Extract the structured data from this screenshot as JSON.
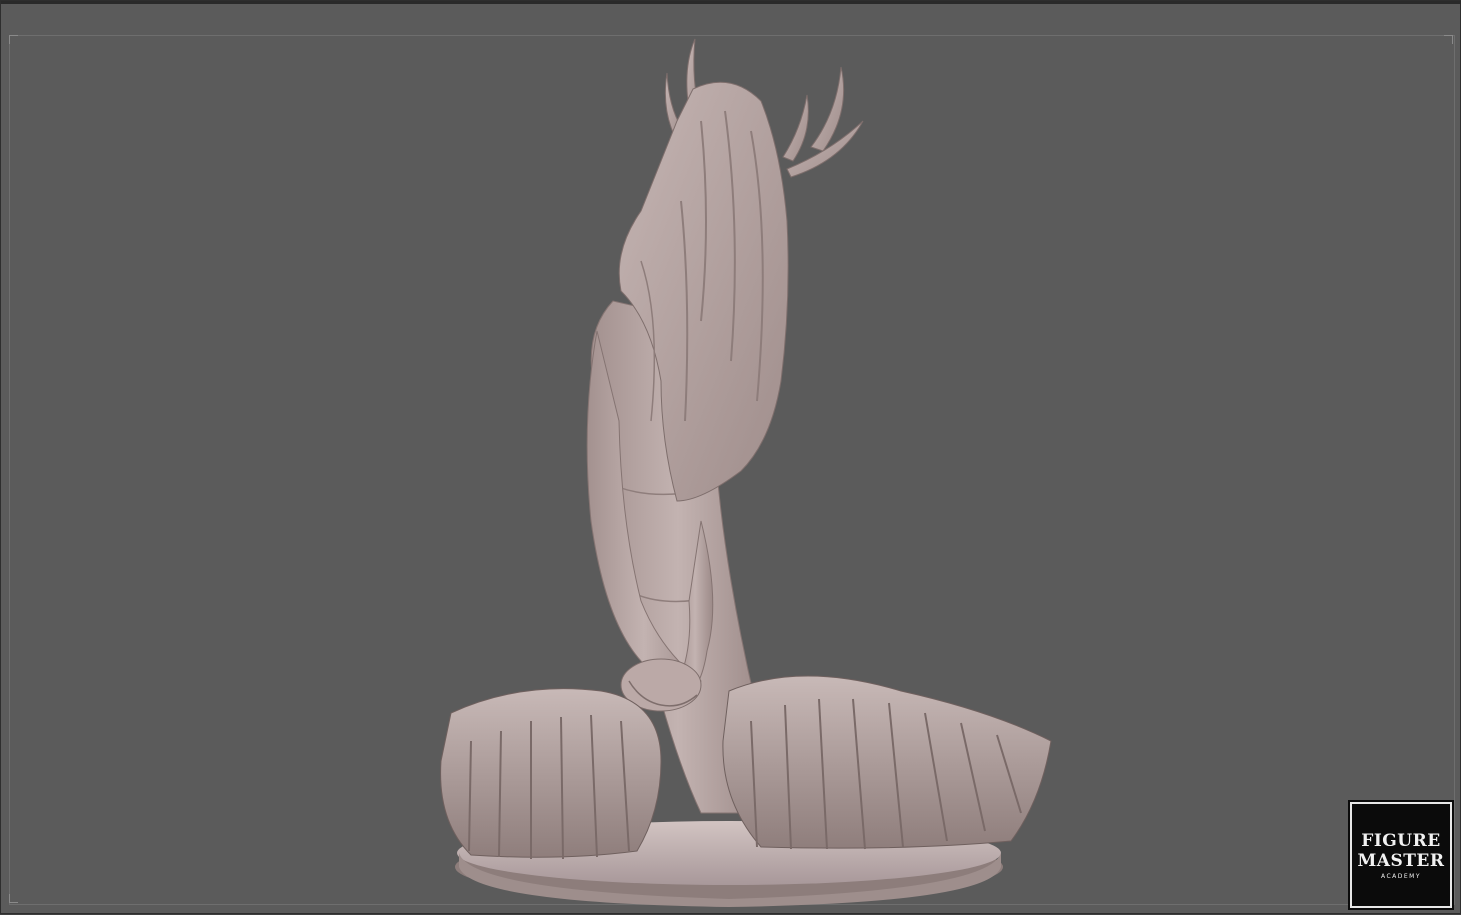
{
  "viewport": {
    "background": "#5b5b5b",
    "subject": "sculpt-render",
    "material_color": "#b9a9a7"
  },
  "logo": {
    "line1": "FIGURE",
    "line2": "MASTER",
    "line3": "ACADEMY"
  }
}
